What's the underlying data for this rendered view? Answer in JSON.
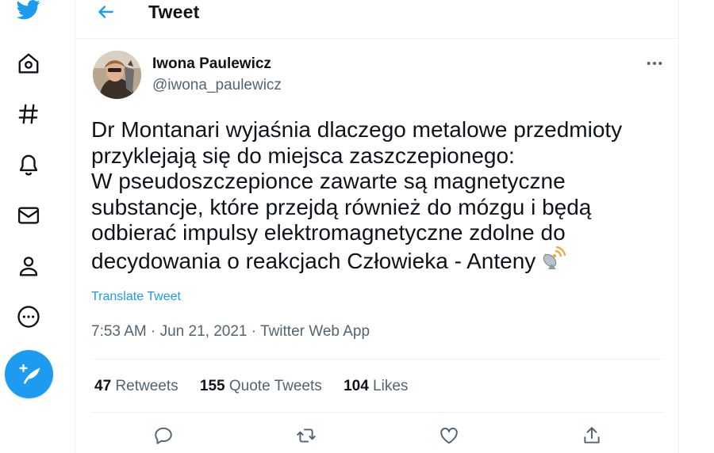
{
  "colors": {
    "accent": "#1d9bf0",
    "text": "#0f1419",
    "muted": "#536471",
    "border": "#eff3f4"
  },
  "sidebar": {
    "items": [
      {
        "icon": "twitter-logo-icon"
      },
      {
        "icon": "home-icon"
      },
      {
        "icon": "hashtag-icon"
      },
      {
        "icon": "bell-icon"
      },
      {
        "icon": "envelope-icon"
      },
      {
        "icon": "profile-icon"
      },
      {
        "icon": "more-icon"
      }
    ],
    "compose_icon": "compose-tweet-icon"
  },
  "header": {
    "title": "Tweet",
    "back_icon": "arrow-left-icon"
  },
  "tweet": {
    "author": {
      "name": "Iwona Paulewicz",
      "handle": "@iwona_paulewicz"
    },
    "text_lines": [
      "Dr Montanari wyjaśnia dlaczego metalowe przedmioty",
      "przyklejają się do miejsca zaszczepionego:",
      "W pseudoszczepionce zawarte są magnetyczne",
      "substancje, które przejdą również do mózgu i będą",
      "odbierać impulsy elektromagnetyczne zdolne do",
      "decydowania o reakcjach Człowieka - Anteny"
    ],
    "emoji": "satellite-antenna-icon",
    "translate_label": "Translate Tweet",
    "time": "7:53 AM",
    "date": "Jun 21, 2021",
    "source": "Twitter Web App",
    "separator": " · ",
    "stats": {
      "retweets": {
        "count": "47",
        "label": "Retweets"
      },
      "quotes": {
        "count": "155",
        "label": "Quote Tweets"
      },
      "likes": {
        "count": "104",
        "label": "Likes"
      }
    },
    "actions": [
      "reply-icon",
      "retweet-icon",
      "like-icon",
      "share-icon"
    ]
  }
}
